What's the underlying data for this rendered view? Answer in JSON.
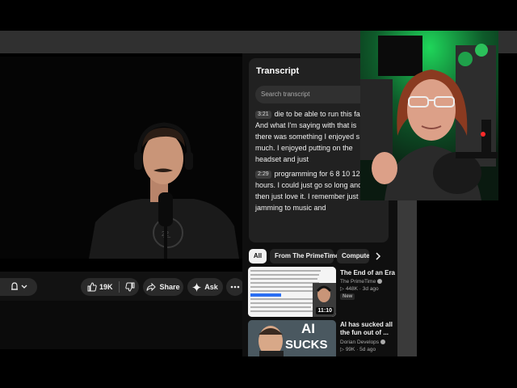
{
  "transcript": {
    "title": "Transcript",
    "search_placeholder": "Search transcript",
    "segments": [
      {
        "time": "3:21",
        "lines": [
          "die to be able to run this fa",
          "And what I'm saying with that is",
          "there was something I enjoyed s",
          "much. I enjoyed putting on the",
          "headset and just"
        ]
      },
      {
        "time": "2:29",
        "lines": [
          "programming for 6 8 10 12",
          "hours. I could just go so long and",
          "then just love it. I remember just",
          "jamming to music and"
        ]
      }
    ]
  },
  "actions": {
    "like_count": "19K",
    "share_label": "Share",
    "ask_label": "Ask"
  },
  "chips": [
    "All",
    "From The PrimeTime",
    "Compute"
  ],
  "recommended": [
    {
      "title_lines": [
        "The End of an Era"
      ],
      "channel": "The PrimeTime",
      "views": "448K",
      "age": "3d ago",
      "badge": "New",
      "duration": "11:10"
    },
    {
      "title_lines": [
        "AI has sucked all",
        "the fun out of ..."
      ],
      "channel": "Dorian Develops",
      "views": "99K",
      "age": "5d ago",
      "thumb_text_1": "AI",
      "thumb_text_2": "SUCKS"
    }
  ],
  "colors": {
    "accent_green": "#1fd65a",
    "panel": "#212121",
    "highlight": "#2a6ef2"
  }
}
